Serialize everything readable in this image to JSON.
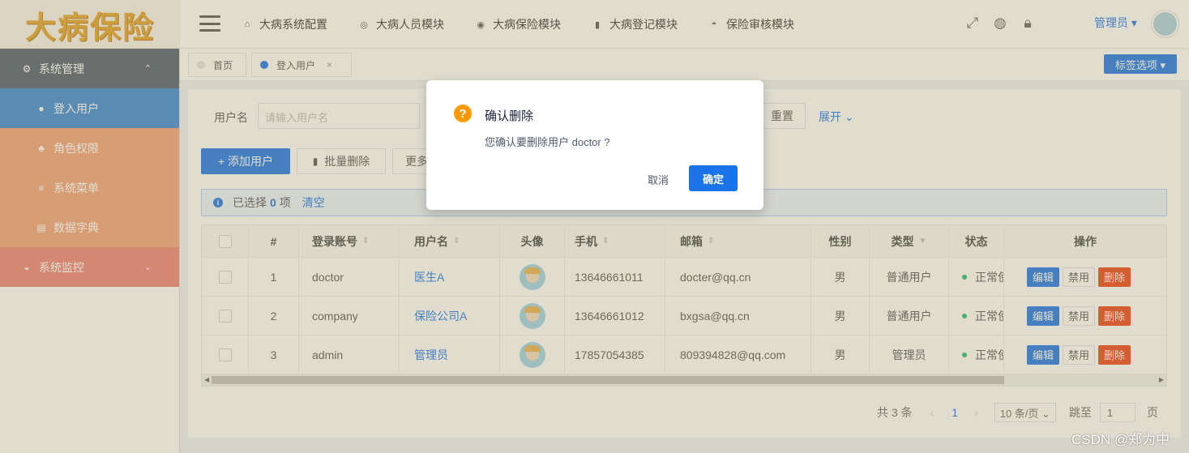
{
  "app": {
    "logo_text": "大病保险"
  },
  "header": {
    "nav": [
      {
        "label": "大病系统配置",
        "icon": "home-icon"
      },
      {
        "label": "大病人员模块",
        "icon": "people-icon"
      },
      {
        "label": "大病保险模块",
        "icon": "shield-icon"
      },
      {
        "label": "大病登记模块",
        "icon": "book-icon"
      },
      {
        "label": "保险审核模块",
        "icon": "audit-icon"
      }
    ],
    "user_label": "管理员 ▾"
  },
  "sidebar": {
    "items": [
      {
        "label": "系统管理",
        "icon": "gear-icon",
        "arrow": "⌃"
      },
      {
        "label": "登入用户",
        "icon": "user-icon"
      },
      {
        "label": "角色权限",
        "icon": "role-icon"
      },
      {
        "label": "系统菜单",
        "icon": "menu-icon"
      },
      {
        "label": "数据字典",
        "icon": "dict-icon"
      },
      {
        "label": "系统监控",
        "icon": "monitor-icon",
        "arrow": "⌄"
      }
    ]
  },
  "tags": {
    "items": [
      {
        "label": "首页"
      },
      {
        "label": "登入用户",
        "close": "×"
      }
    ],
    "options_label": "标签选项 ▾"
  },
  "search": {
    "username_label": "用户名",
    "username_placeholder": "请输入用户名",
    "reset_label": "重置",
    "expand_label": "展开 ⌄"
  },
  "toolbar": {
    "add_label": "+ 添加用户",
    "batch_delete_label": "批量删除",
    "more_label": "更多"
  },
  "selection": {
    "prefix": "已选择",
    "count": "0",
    "suffix": "项",
    "clear": "清空"
  },
  "table": {
    "headers": [
      "#",
      "登录账号",
      "用户名",
      "头像",
      "手机",
      "邮箱",
      "性别",
      "类型",
      "状态",
      "操作"
    ],
    "rows": [
      {
        "index": "1",
        "account": "doctor",
        "name": "医生A",
        "phone": "13646661011",
        "email": "docter@qq.cn",
        "sex": "男",
        "type": "普通用户",
        "status": "正常使用"
      },
      {
        "index": "2",
        "account": "company",
        "name": "保险公司A",
        "phone": "13646661012",
        "email": "bxgsa@qq.cn",
        "sex": "男",
        "type": "普通用户",
        "status": "正常使用"
      },
      {
        "index": "3",
        "account": "admin",
        "name": "管理员",
        "phone": "17857054385",
        "email": "809394828@qq.com",
        "sex": "男",
        "type": "管理员",
        "status": "正常使用"
      }
    ],
    "actions": {
      "edit": "编辑",
      "disable": "禁用",
      "delete": "删除"
    }
  },
  "pager": {
    "total": "共 3 条",
    "prev": "‹",
    "current": "1",
    "next": "›",
    "page_size": "10 条/页 ⌄",
    "jump_label": "跳至",
    "jump_value": "1",
    "page_suffix": "页"
  },
  "modal": {
    "title": "确认删除",
    "content": "您确认要删除用户 doctor ?",
    "cancel": "取消",
    "ok": "确定"
  },
  "watermark": "CSDN @郑为中"
}
